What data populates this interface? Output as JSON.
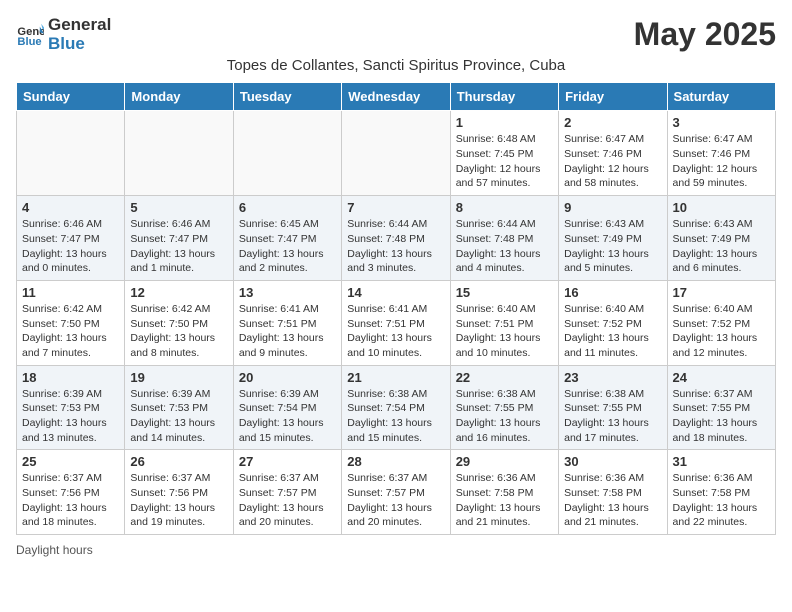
{
  "header": {
    "logo_general": "General",
    "logo_blue": "Blue",
    "month": "May 2025",
    "location": "Topes de Collantes, Sancti Spiritus Province, Cuba"
  },
  "days_of_week": [
    "Sunday",
    "Monday",
    "Tuesday",
    "Wednesday",
    "Thursday",
    "Friday",
    "Saturday"
  ],
  "weeks": [
    [
      {
        "day": "",
        "info": ""
      },
      {
        "day": "",
        "info": ""
      },
      {
        "day": "",
        "info": ""
      },
      {
        "day": "",
        "info": ""
      },
      {
        "day": "1",
        "info": "Sunrise: 6:48 AM\nSunset: 7:45 PM\nDaylight: 12 hours\nand 57 minutes."
      },
      {
        "day": "2",
        "info": "Sunrise: 6:47 AM\nSunset: 7:46 PM\nDaylight: 12 hours\nand 58 minutes."
      },
      {
        "day": "3",
        "info": "Sunrise: 6:47 AM\nSunset: 7:46 PM\nDaylight: 12 hours\nand 59 minutes."
      }
    ],
    [
      {
        "day": "4",
        "info": "Sunrise: 6:46 AM\nSunset: 7:47 PM\nDaylight: 13 hours\nand 0 minutes."
      },
      {
        "day": "5",
        "info": "Sunrise: 6:46 AM\nSunset: 7:47 PM\nDaylight: 13 hours\nand 1 minute."
      },
      {
        "day": "6",
        "info": "Sunrise: 6:45 AM\nSunset: 7:47 PM\nDaylight: 13 hours\nand 2 minutes."
      },
      {
        "day": "7",
        "info": "Sunrise: 6:44 AM\nSunset: 7:48 PM\nDaylight: 13 hours\nand 3 minutes."
      },
      {
        "day": "8",
        "info": "Sunrise: 6:44 AM\nSunset: 7:48 PM\nDaylight: 13 hours\nand 4 minutes."
      },
      {
        "day": "9",
        "info": "Sunrise: 6:43 AM\nSunset: 7:49 PM\nDaylight: 13 hours\nand 5 minutes."
      },
      {
        "day": "10",
        "info": "Sunrise: 6:43 AM\nSunset: 7:49 PM\nDaylight: 13 hours\nand 6 minutes."
      }
    ],
    [
      {
        "day": "11",
        "info": "Sunrise: 6:42 AM\nSunset: 7:50 PM\nDaylight: 13 hours\nand 7 minutes."
      },
      {
        "day": "12",
        "info": "Sunrise: 6:42 AM\nSunset: 7:50 PM\nDaylight: 13 hours\nand 8 minutes."
      },
      {
        "day": "13",
        "info": "Sunrise: 6:41 AM\nSunset: 7:51 PM\nDaylight: 13 hours\nand 9 minutes."
      },
      {
        "day": "14",
        "info": "Sunrise: 6:41 AM\nSunset: 7:51 PM\nDaylight: 13 hours\nand 10 minutes."
      },
      {
        "day": "15",
        "info": "Sunrise: 6:40 AM\nSunset: 7:51 PM\nDaylight: 13 hours\nand 10 minutes."
      },
      {
        "day": "16",
        "info": "Sunrise: 6:40 AM\nSunset: 7:52 PM\nDaylight: 13 hours\nand 11 minutes."
      },
      {
        "day": "17",
        "info": "Sunrise: 6:40 AM\nSunset: 7:52 PM\nDaylight: 13 hours\nand 12 minutes."
      }
    ],
    [
      {
        "day": "18",
        "info": "Sunrise: 6:39 AM\nSunset: 7:53 PM\nDaylight: 13 hours\nand 13 minutes."
      },
      {
        "day": "19",
        "info": "Sunrise: 6:39 AM\nSunset: 7:53 PM\nDaylight: 13 hours\nand 14 minutes."
      },
      {
        "day": "20",
        "info": "Sunrise: 6:39 AM\nSunset: 7:54 PM\nDaylight: 13 hours\nand 15 minutes."
      },
      {
        "day": "21",
        "info": "Sunrise: 6:38 AM\nSunset: 7:54 PM\nDaylight: 13 hours\nand 15 minutes."
      },
      {
        "day": "22",
        "info": "Sunrise: 6:38 AM\nSunset: 7:55 PM\nDaylight: 13 hours\nand 16 minutes."
      },
      {
        "day": "23",
        "info": "Sunrise: 6:38 AM\nSunset: 7:55 PM\nDaylight: 13 hours\nand 17 minutes."
      },
      {
        "day": "24",
        "info": "Sunrise: 6:37 AM\nSunset: 7:55 PM\nDaylight: 13 hours\nand 18 minutes."
      }
    ],
    [
      {
        "day": "25",
        "info": "Sunrise: 6:37 AM\nSunset: 7:56 PM\nDaylight: 13 hours\nand 18 minutes."
      },
      {
        "day": "26",
        "info": "Sunrise: 6:37 AM\nSunset: 7:56 PM\nDaylight: 13 hours\nand 19 minutes."
      },
      {
        "day": "27",
        "info": "Sunrise: 6:37 AM\nSunset: 7:57 PM\nDaylight: 13 hours\nand 20 minutes."
      },
      {
        "day": "28",
        "info": "Sunrise: 6:37 AM\nSunset: 7:57 PM\nDaylight: 13 hours\nand 20 minutes."
      },
      {
        "day": "29",
        "info": "Sunrise: 6:36 AM\nSunset: 7:58 PM\nDaylight: 13 hours\nand 21 minutes."
      },
      {
        "day": "30",
        "info": "Sunrise: 6:36 AM\nSunset: 7:58 PM\nDaylight: 13 hours\nand 21 minutes."
      },
      {
        "day": "31",
        "info": "Sunrise: 6:36 AM\nSunset: 7:58 PM\nDaylight: 13 hours\nand 22 minutes."
      }
    ]
  ],
  "footer": {
    "daylight_label": "Daylight hours"
  }
}
